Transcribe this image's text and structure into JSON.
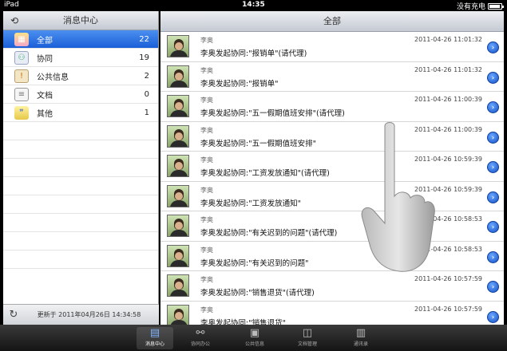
{
  "status_bar": {
    "device": "iPad",
    "time": "14:35",
    "charging": "没有充电"
  },
  "left_pane": {
    "title": "消息中心",
    "folders": [
      {
        "label": "全部",
        "count": "22",
        "icon": "all-messages-icon",
        "selected": true
      },
      {
        "label": "协同",
        "count": "19",
        "icon": "collaboration-icon",
        "selected": false
      },
      {
        "label": "公共信息",
        "count": "2",
        "icon": "public-info-icon",
        "selected": false
      },
      {
        "label": "文档",
        "count": "0",
        "icon": "document-icon",
        "selected": false
      },
      {
        "label": "其他",
        "count": "1",
        "icon": "chat-bubble-icon",
        "selected": false
      }
    ],
    "updated": "更新于 2011年04月26日 14:34:58"
  },
  "right_pane": {
    "title": "全部",
    "messages": [
      {
        "sender": "李奥",
        "time": "2011-04-26 11:01:32",
        "subject": "李奥发起协同:\"报销单\"(请代理)"
      },
      {
        "sender": "李奥",
        "time": "2011-04-26 11:01:32",
        "subject": "李奥发起协同:\"报销单\""
      },
      {
        "sender": "李奥",
        "time": "2011-04-26 11:00:39",
        "subject": "李奥发起协同:\"五一假期值班安排\"(请代理)"
      },
      {
        "sender": "李奥",
        "time": "2011-04-26 11:00:39",
        "subject": "李奥发起协同:\"五一假期值班安排\""
      },
      {
        "sender": "李奥",
        "time": "2011-04-26 10:59:39",
        "subject": "李奥发起协同:\"工资发放通知\"(请代理)"
      },
      {
        "sender": "李奥",
        "time": "2011-04-26 10:59:39",
        "subject": "李奥发起协同:\"工资发放通知\""
      },
      {
        "sender": "李奥",
        "time": "2011-04-26 10:58:53",
        "subject": "李奥发起协同:\"有关迟到的问题\"(请代理)"
      },
      {
        "sender": "李奥",
        "time": "2011-04-26 10:58:53",
        "subject": "李奥发起协同:\"有关迟到的问题\""
      },
      {
        "sender": "李奥",
        "time": "2011-04-26 10:57:59",
        "subject": "李奥发起协同:\"销售退货\"(请代理)"
      },
      {
        "sender": "李奥",
        "time": "2011-04-26 10:57:59",
        "subject": "李奥发起协同:\"销售退货\""
      }
    ]
  },
  "tab_bar": {
    "tabs": [
      {
        "label": "消息中心",
        "icon": "inbox-icon",
        "active": true
      },
      {
        "label": "协同办公",
        "icon": "workflow-icon",
        "active": false
      },
      {
        "label": "公共信息",
        "icon": "bulletin-icon",
        "active": false
      },
      {
        "label": "文档管理",
        "icon": "document-manage-icon",
        "active": false
      },
      {
        "label": "通讯录",
        "icon": "contacts-icon",
        "active": false
      }
    ]
  },
  "colors": {
    "selection": "#1b5fd8",
    "disclosure": "#1451c6"
  }
}
